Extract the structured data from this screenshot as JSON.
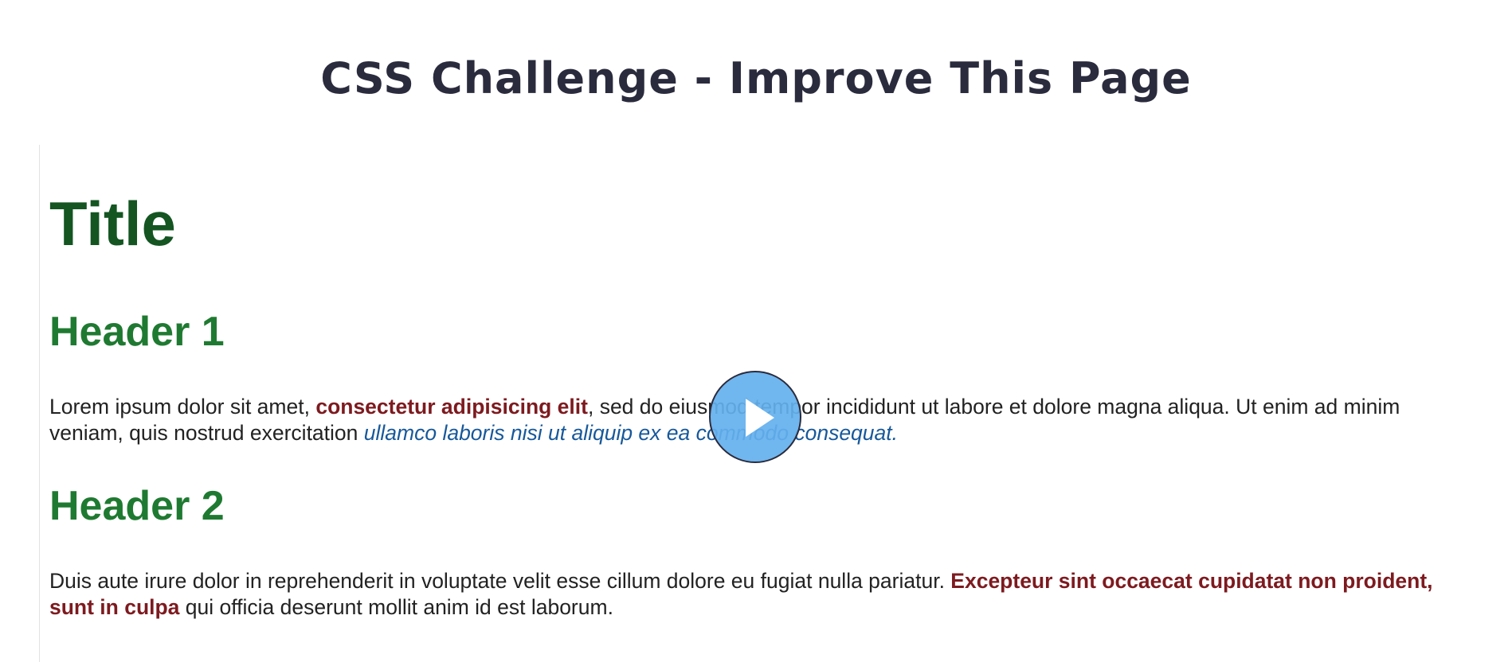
{
  "page": {
    "heading": "CSS Challenge - Improve This Page"
  },
  "preview": {
    "title": "Title",
    "section1": {
      "header": "Header 1",
      "text_a": "Lorem ipsum dolor sit amet, ",
      "bold": "consectetur adipisicing elit",
      "text_b": ", sed do eiusmod tempor incididunt ut labore et dolore magna aliqua. Ut enim ad minim veniam, quis nostrud exercitation ",
      "italic": "ullamco laboris nisi ut aliquip ex ea commodo consequat."
    },
    "section2": {
      "header": "Header 2",
      "text_a": "Duis aute irure dolor in reprehenderit in voluptate velit esse cillum dolore eu fugiat nulla pariatur. ",
      "bold": "Excepteur sint occaecat cupidatat non proident, sunt in culpa",
      "text_b": " qui officia deserunt mollit anim id est laborum."
    }
  },
  "video": {
    "play_icon": "play-icon"
  },
  "colors": {
    "heading": "#2a2b3d",
    "title": "#145522",
    "header": "#1f7a31",
    "bold_text": "#7d1a1f",
    "italic_text": "#17589a",
    "play_button": "#64b0ee"
  }
}
